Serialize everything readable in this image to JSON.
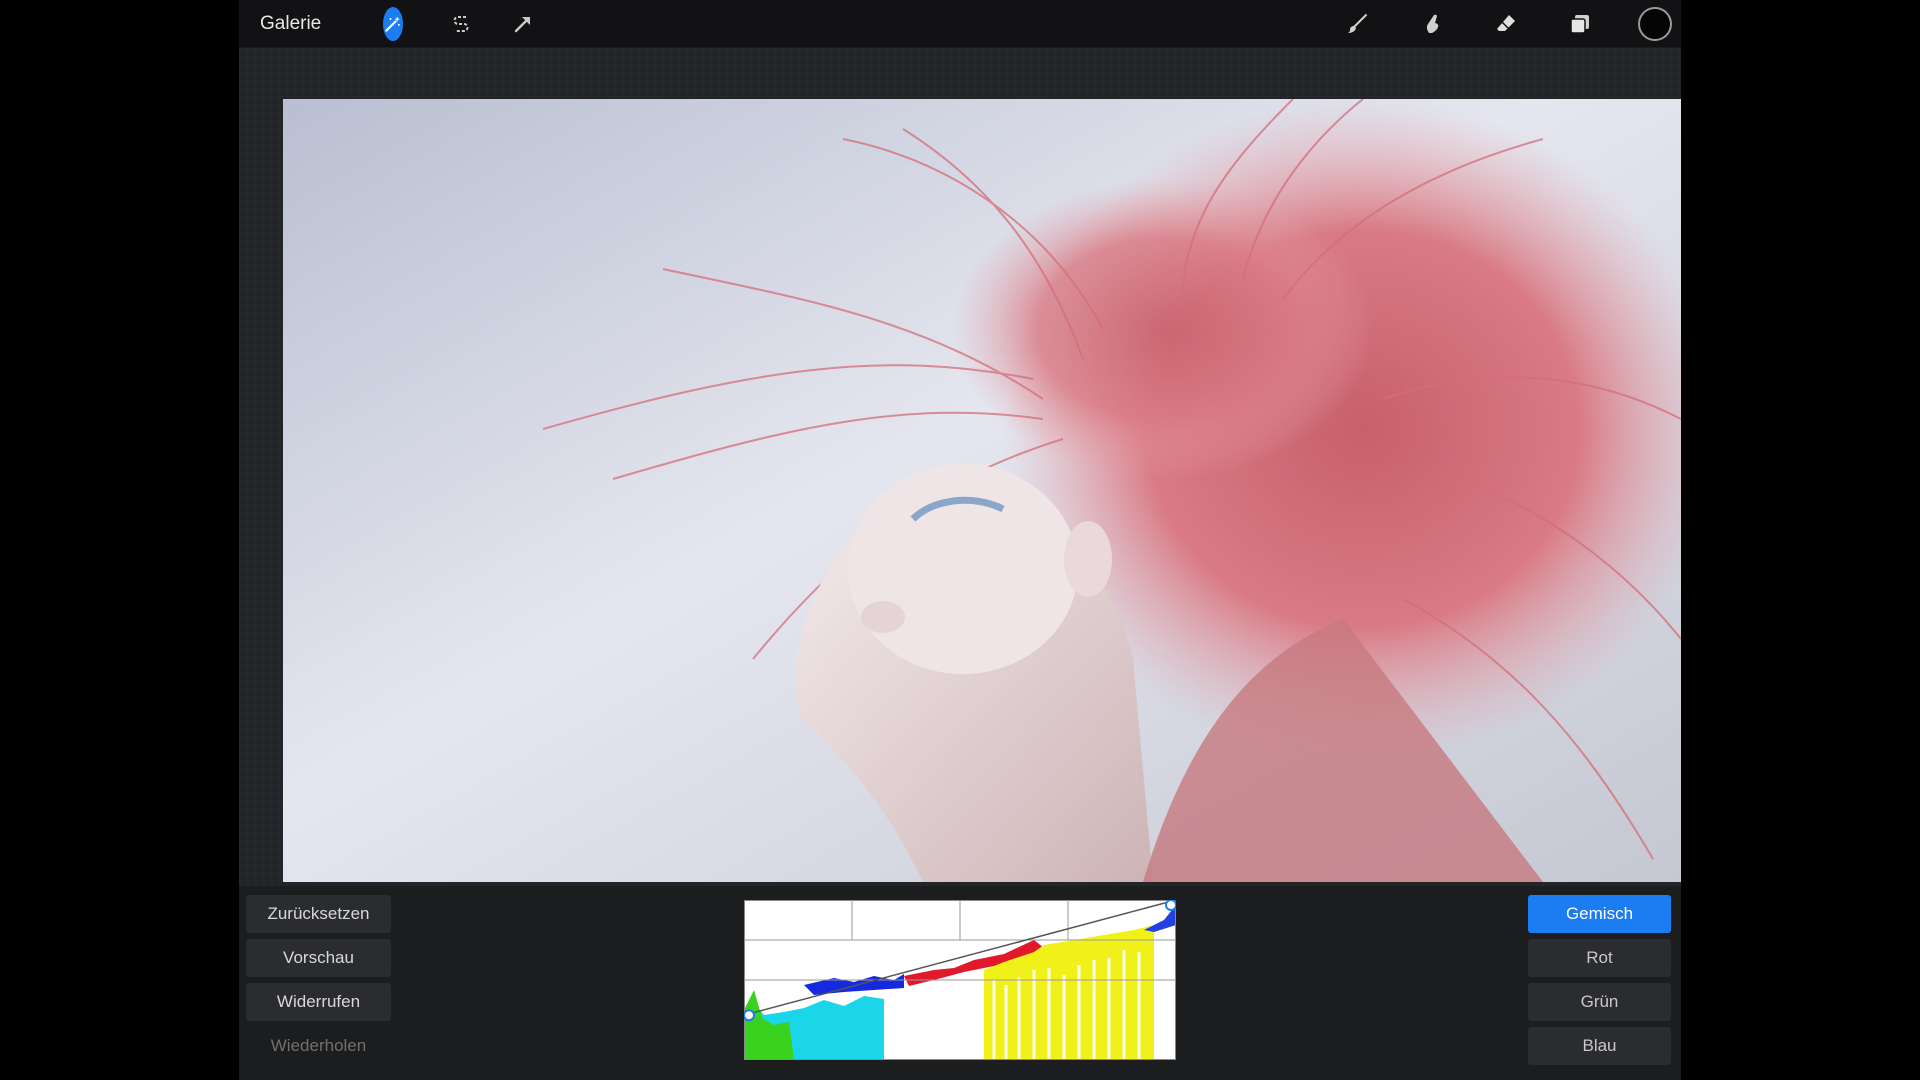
{
  "toolbar": {
    "gallery_label": "Galerie",
    "left_tools": [
      {
        "name": "actions",
        "icon": "wrench-icon",
        "active": false
      },
      {
        "name": "adjustments",
        "icon": "magic-wand-icon",
        "active": true
      },
      {
        "name": "selection",
        "icon": "selection-s-icon",
        "active": false
      },
      {
        "name": "transform",
        "icon": "arrow-icon",
        "active": false
      }
    ],
    "right_tools": [
      {
        "name": "brush",
        "icon": "brush-icon"
      },
      {
        "name": "smudge",
        "icon": "smudge-icon"
      },
      {
        "name": "eraser",
        "icon": "eraser-icon"
      },
      {
        "name": "layers",
        "icon": "layers-icon"
      },
      {
        "name": "color",
        "icon": "color-swatch-icon"
      }
    ],
    "accent_color": "#1c7cf2"
  },
  "canvas": {
    "image": "photo-woman-pink-hair"
  },
  "panel": {
    "left_buttons": [
      {
        "label": "Zurücksetzen",
        "enabled": true
      },
      {
        "label": "Vorschau",
        "enabled": true
      },
      {
        "label": "Widerrufen",
        "enabled": true
      },
      {
        "label": "Wiederholen",
        "enabled": false
      }
    ],
    "channels": [
      {
        "label": "Gemisch",
        "active": true
      },
      {
        "label": "Rot",
        "active": false
      },
      {
        "label": "Grün",
        "active": false
      },
      {
        "label": "Blau",
        "active": false
      }
    ],
    "curve": {
      "points": [
        [
          0,
          0.28
        ],
        [
          1,
          1.0
        ]
      ]
    }
  }
}
